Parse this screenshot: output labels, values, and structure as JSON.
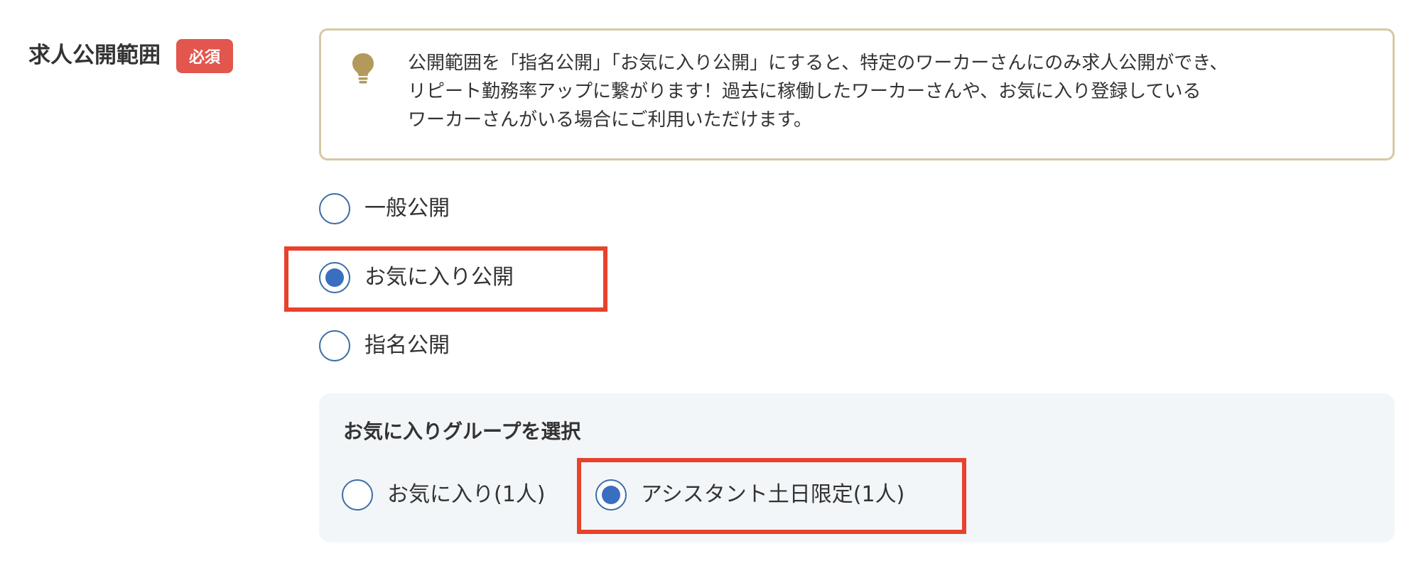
{
  "field": {
    "label": "求人公開範囲",
    "required_badge": "必須"
  },
  "notice": {
    "icon": "lightbulb-icon",
    "lines": [
      "公開範囲を「指名公開」「お気に入り公開」にすると、特定のワーカーさんにのみ求人公開ができ、",
      "リピート勤務率アップに繋がります！過去に稼働したワーカーさんや、お気に入り登録している",
      "ワーカーさんがいる場合にご利用いただけます。"
    ]
  },
  "visibility_options": [
    {
      "label": "一般公開",
      "checked": false
    },
    {
      "label": "お気に入り公開",
      "checked": true
    },
    {
      "label": "指名公開",
      "checked": false
    }
  ],
  "favorite_group": {
    "title": "お気に入りグループを選択",
    "options": [
      {
        "label": "お気に入り(1人)",
        "checked": false
      },
      {
        "label": "アシスタント土日限定(1人)",
        "checked": true
      }
    ]
  },
  "colors": {
    "required_badge": "#e2564d",
    "radio_accent": "#3a6ec0",
    "highlight": "#e8412c",
    "notice_border": "#d5c9a5",
    "panel_bg": "#f3f6f8",
    "bulb": "#b39a5a"
  }
}
